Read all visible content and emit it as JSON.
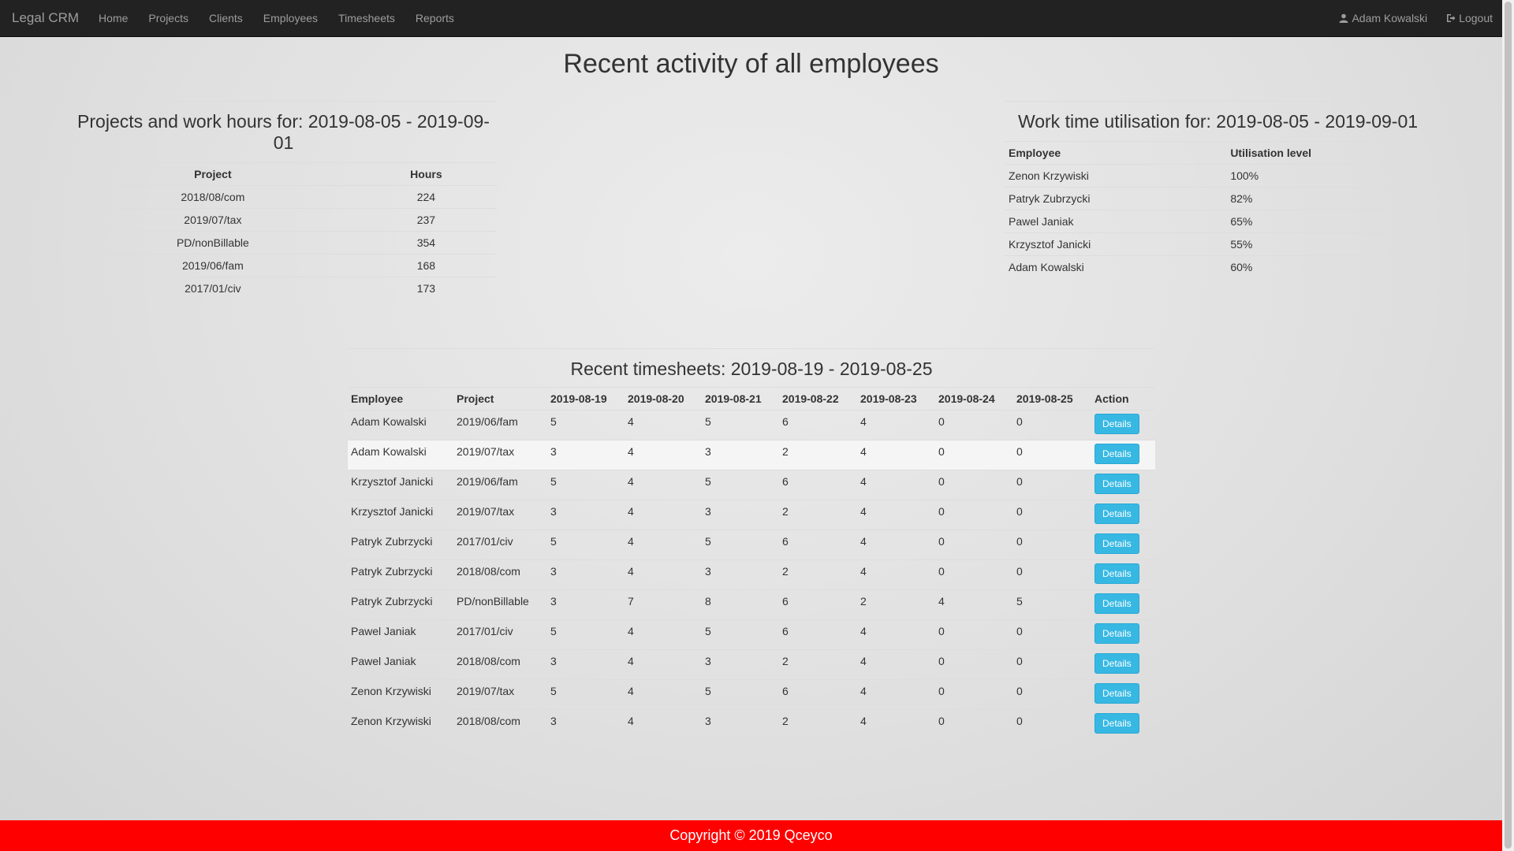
{
  "navbar": {
    "brand": "Legal CRM",
    "items": [
      "Home",
      "Projects",
      "Clients",
      "Employees",
      "Timesheets",
      "Reports"
    ],
    "user": "Adam Kowalski",
    "logout": "Logout"
  },
  "page_title": "Recent activity of all employees",
  "projects_panel": {
    "title": "Projects and work hours for: 2019-08-05 - 2019-09-01",
    "headers": [
      "Project",
      "Hours"
    ],
    "rows": [
      [
        "2018/08/com",
        "224"
      ],
      [
        "2019/07/tax",
        "237"
      ],
      [
        "PD/nonBillable",
        "354"
      ],
      [
        "2019/06/fam",
        "168"
      ],
      [
        "2017/01/civ",
        "173"
      ]
    ]
  },
  "utilisation_panel": {
    "title": "Work time utilisation for: 2019-08-05 - 2019-09-01",
    "headers": [
      "Employee",
      "Utilisation level"
    ],
    "rows": [
      [
        "Zenon Krzywiski",
        "100%"
      ],
      [
        "Patryk Zubrzycki",
        "82%"
      ],
      [
        "Pawel Janiak",
        "65%"
      ],
      [
        "Krzysztof Janicki",
        "55%"
      ],
      [
        "Adam Kowalski",
        "60%"
      ]
    ]
  },
  "timesheets": {
    "title": "Recent timesheets: 2019-08-19 - 2019-08-25",
    "headers": [
      "Employee",
      "Project",
      "2019-08-19",
      "2019-08-20",
      "2019-08-21",
      "2019-08-22",
      "2019-08-23",
      "2019-08-24",
      "2019-08-25",
      "Action"
    ],
    "action_label": "Details",
    "rows": [
      [
        "Adam Kowalski",
        "2019/06/fam",
        "5",
        "4",
        "5",
        "6",
        "4",
        "0",
        "0"
      ],
      [
        "Adam Kowalski",
        "2019/07/tax",
        "3",
        "4",
        "3",
        "2",
        "4",
        "0",
        "0"
      ],
      [
        "Krzysztof Janicki",
        "2019/06/fam",
        "5",
        "4",
        "5",
        "6",
        "4",
        "0",
        "0"
      ],
      [
        "Krzysztof Janicki",
        "2019/07/tax",
        "3",
        "4",
        "3",
        "2",
        "4",
        "0",
        "0"
      ],
      [
        "Patryk Zubrzycki",
        "2017/01/civ",
        "5",
        "4",
        "5",
        "6",
        "4",
        "0",
        "0"
      ],
      [
        "Patryk Zubrzycki",
        "2018/08/com",
        "3",
        "4",
        "3",
        "2",
        "4",
        "0",
        "0"
      ],
      [
        "Patryk Zubrzycki",
        "PD/nonBillable",
        "3",
        "7",
        "8",
        "6",
        "2",
        "4",
        "5"
      ],
      [
        "Pawel Janiak",
        "2017/01/civ",
        "5",
        "4",
        "5",
        "6",
        "4",
        "0",
        "0"
      ],
      [
        "Pawel Janiak",
        "2018/08/com",
        "3",
        "4",
        "3",
        "2",
        "4",
        "0",
        "0"
      ],
      [
        "Zenon Krzywiski",
        "2019/07/tax",
        "5",
        "4",
        "5",
        "6",
        "4",
        "0",
        "0"
      ],
      [
        "Zenon Krzywiski",
        "2018/08/com",
        "3",
        "4",
        "3",
        "2",
        "4",
        "0",
        "0"
      ]
    ]
  },
  "footer": "Copyright © 2019 Qceyco",
  "colors": {
    "navbar_bg": "#222222",
    "button": "#36b8e3",
    "footer_bg": "#ff0000"
  }
}
